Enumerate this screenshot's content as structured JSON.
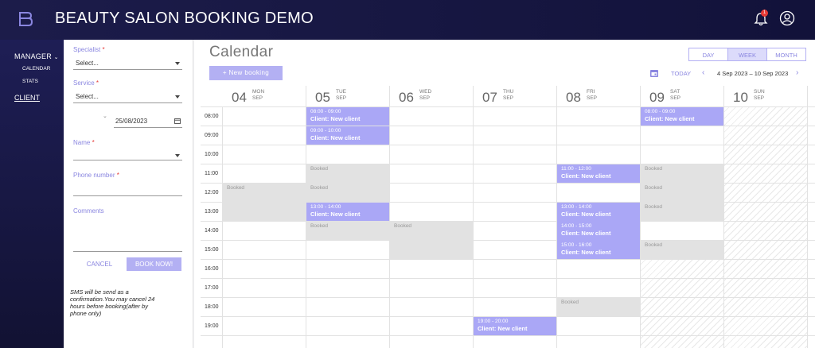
{
  "app": {
    "title": "BEAUTY SALON BOOKING DEMO",
    "notification_count": "1"
  },
  "nav": {
    "manager": "MANAGER",
    "calendar": "CALENDAR",
    "stats": "STATS",
    "client": "CLIENT"
  },
  "form": {
    "specialist_label": "Specialist",
    "specialist_value": "Select...",
    "service_label": "Service",
    "service_value": "Select...",
    "date_value": "25/08/2023",
    "name_label": "Name",
    "phone_label": "Phone number",
    "comments_label": "Comments",
    "required_mark": "*",
    "cancel": "CANCEL",
    "book_now": "BOOK NOW!",
    "sms_note": "SMS will be send as a confirmation.You may cancel 24 hours before booking(after by phone only)"
  },
  "calendar": {
    "title": "Calendar",
    "new_booking": "+ New booking",
    "views": [
      "DAY",
      "WEEK",
      "MONTH"
    ],
    "active_view": "WEEK",
    "today": "TODAY",
    "range": "4 Sep 2023 – 10 Sep 2023",
    "days": [
      {
        "num": "04",
        "name": "MON",
        "month": "SEP"
      },
      {
        "num": "05",
        "name": "TUE",
        "month": "SEP"
      },
      {
        "num": "06",
        "name": "WED",
        "month": "SEP"
      },
      {
        "num": "07",
        "name": "THU",
        "month": "SEP"
      },
      {
        "num": "08",
        "name": "FRI",
        "month": "SEP"
      },
      {
        "num": "09",
        "name": "SAT",
        "month": "SEP"
      },
      {
        "num": "10",
        "name": "SUN",
        "month": "SEP"
      }
    ],
    "hours": [
      "08:00",
      "09:00",
      "10:00",
      "11:00",
      "12:00",
      "13:00",
      "14:00",
      "15:00",
      "16:00",
      "17:00",
      "18:00",
      "19:00"
    ],
    "events": [
      {
        "time": "08:00 - 09:00",
        "client": "Client: New client"
      },
      {
        "time": "09:00 - 10:00",
        "client": "Client: New client"
      },
      {
        "time": "13:00 - 14:00",
        "client": "Client: New client"
      },
      {
        "time": "19:00 - 20:00",
        "client": "Client: New client"
      },
      {
        "time": "11:00 - 12:00",
        "client": "Client: New client"
      },
      {
        "time": "13:00 - 14:00",
        "client": "Client: New client"
      },
      {
        "time": "14:00 - 15:00",
        "client": "Client: New client"
      },
      {
        "time": "15:00 - 16:00",
        "client": "Client: New client"
      },
      {
        "time": "08:00 - 09:00",
        "client": "Client: New client"
      }
    ],
    "booked_label": "Booked"
  },
  "colors": {
    "accent": "#aaa7f6",
    "topbar": "#1c1c4a",
    "booked": "#e2e2e2"
  }
}
